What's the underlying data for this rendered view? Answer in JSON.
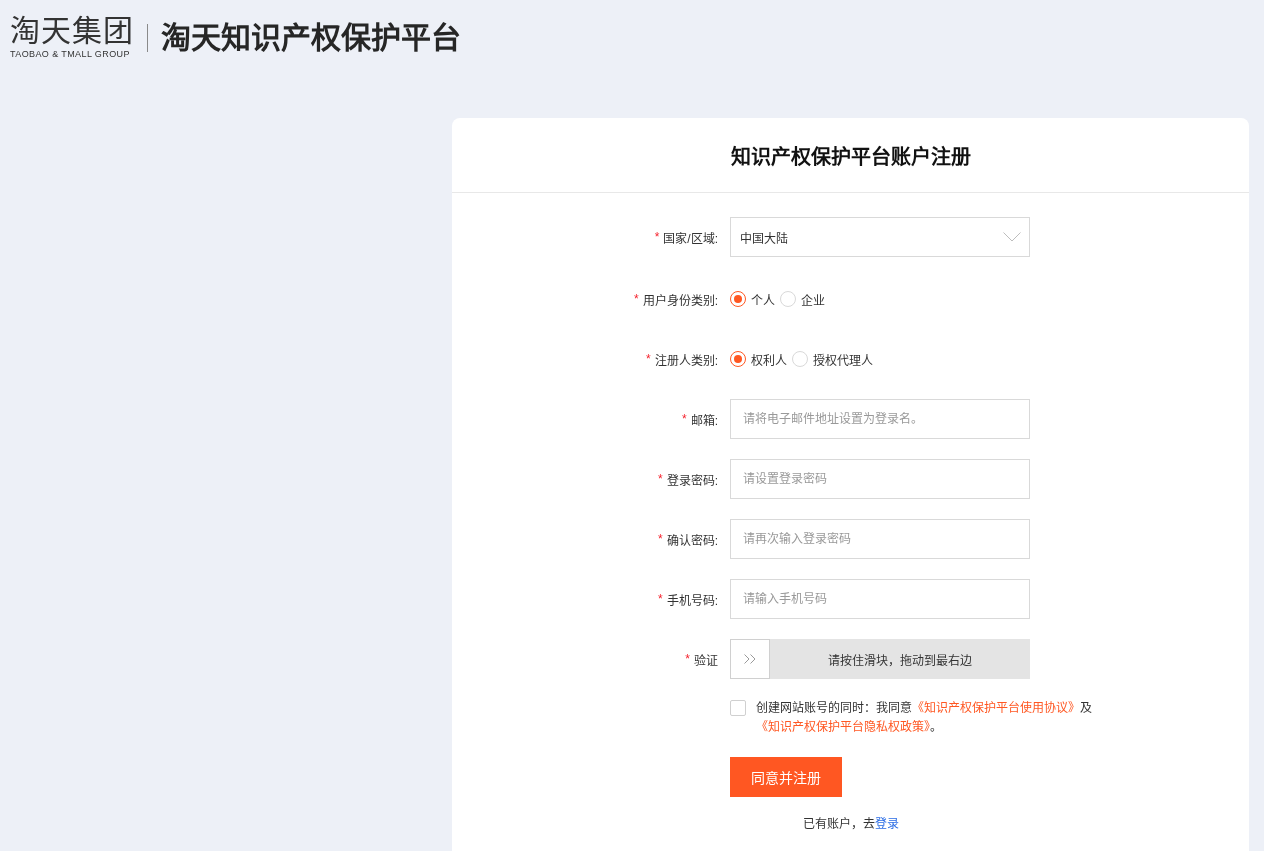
{
  "header": {
    "logo": {
      "wordmark": "淘天集团",
      "tagline": "TAOBAO & TMALL GROUP"
    },
    "title": "淘天知识产权保护平台"
  },
  "card": {
    "title": "知识产权保护平台账户注册",
    "fields": [
      {
        "kind": "select",
        "required_mark": "*",
        "label": "国家/区域:",
        "value": "中国大陆"
      },
      {
        "kind": "radio",
        "required_mark": "*",
        "label": "用户身份类别:",
        "options": [
          {
            "label": "个人",
            "selected": true
          },
          {
            "label": "企业",
            "selected": false
          }
        ]
      },
      {
        "kind": "radio",
        "required_mark": "*",
        "label": "注册人类别:",
        "options": [
          {
            "label": "权利人",
            "selected": true
          },
          {
            "label": "授权代理人",
            "selected": false
          }
        ]
      },
      {
        "kind": "text",
        "required_mark": "*",
        "label": "邮箱:",
        "placeholder": "请将电子邮件地址设置为登录名。"
      },
      {
        "kind": "text",
        "required_mark": "*",
        "label": "登录密码:",
        "placeholder": "请设置登录密码"
      },
      {
        "kind": "text",
        "required_mark": "*",
        "label": "确认密码:",
        "placeholder": "请再次输入登录密码"
      },
      {
        "kind": "text",
        "required_mark": "*",
        "label": "手机号码:",
        "placeholder": "请输入手机号码"
      },
      {
        "kind": "slider",
        "required_mark": "*",
        "label": "验证",
        "hint": "请按住滑块，拖动到最右边",
        "level": 0
      }
    ],
    "agreement": {
      "checked": false,
      "parts": [
        {
          "kind": "text",
          "text": "创建网站账号的同时：我同意"
        },
        {
          "kind": "link",
          "text": "《知识产权保护平台使用协议》"
        },
        {
          "kind": "text",
          "text": "及"
        },
        {
          "kind": "link",
          "text": "《知识产权保护平台隐私权政策》"
        },
        {
          "kind": "text",
          "text": "。"
        }
      ]
    },
    "submit_button": "同意并注册",
    "login_prompt": {
      "text": "已有账户，去",
      "link": "登录"
    }
  }
}
